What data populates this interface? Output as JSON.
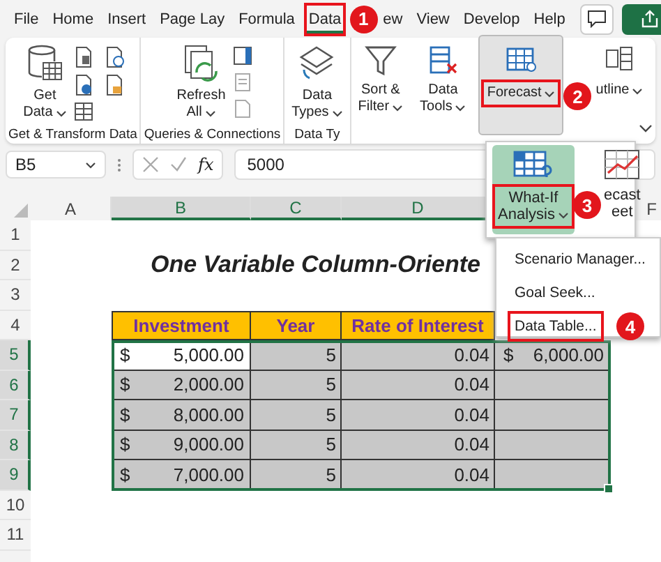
{
  "tabs": [
    {
      "label": "File",
      "selected": false
    },
    {
      "label": "Home",
      "selected": false
    },
    {
      "label": "Insert",
      "selected": false
    },
    {
      "label": "Page Lay",
      "selected": false
    },
    {
      "label": "Formula",
      "selected": false
    },
    {
      "label": "Data",
      "selected": true,
      "step": "1"
    },
    {
      "label": "ew",
      "selected": false
    },
    {
      "label": "View",
      "selected": false
    },
    {
      "label": "Develop",
      "selected": false
    },
    {
      "label": "Help",
      "selected": false
    }
  ],
  "ribbon_groups": [
    {
      "label": "Get & Transform Data",
      "buttons": [
        {
          "lines": [
            "Get",
            "Data"
          ],
          "dropdown": true,
          "pressed": false
        }
      ]
    },
    {
      "label": "Queries & Connections",
      "buttons": [
        {
          "lines": [
            "Refresh",
            "All"
          ],
          "dropdown": true,
          "pressed": false
        }
      ]
    },
    {
      "label": "Data Ty",
      "buttons": [
        {
          "lines": [
            "Data",
            "Types"
          ],
          "dropdown": true,
          "pressed": false
        }
      ]
    },
    {
      "buttons": [
        {
          "lines": [
            "Sort &",
            "Filter"
          ],
          "dropdown": true,
          "pressed": false
        },
        {
          "lines": [
            "Data",
            "Tools"
          ],
          "dropdown": true,
          "pressed": false
        },
        {
          "lines": [
            "Forecast"
          ],
          "dropdown": true,
          "pressed": true,
          "step": "2"
        },
        {
          "lines": [
            "utline"
          ],
          "dropdown": true,
          "pressed": false
        }
      ]
    }
  ],
  "formula_bar": {
    "name_box": "B5",
    "function_button": "fx",
    "value": "5000"
  },
  "forecast_panel": [
    {
      "lines": [
        "What-If",
        "Analysis"
      ],
      "dropdown": true,
      "selected": true,
      "step": "3"
    },
    {
      "lines": [
        "ecast",
        "eet"
      ],
      "dropdown": false,
      "selected": false
    }
  ],
  "what_if_menu": [
    {
      "label": "Scenario Manager..."
    },
    {
      "label": "Goal Seek..."
    },
    {
      "label": "Data Table...",
      "step": "4"
    }
  ],
  "column_headers": [
    {
      "label": "A",
      "selected": false
    },
    {
      "label": "B",
      "selected": true
    },
    {
      "label": "C",
      "selected": true
    },
    {
      "label": "D",
      "selected": true
    },
    {
      "label": "F",
      "selected": false
    }
  ],
  "sheet_rows": [
    {
      "header": "1",
      "selected": false,
      "kind": "blank"
    },
    {
      "header": "2",
      "selected": false,
      "kind": "title",
      "title": "One Variable Column-Oriente"
    },
    {
      "header": "3",
      "selected": false,
      "kind": "blank"
    },
    {
      "header": "4",
      "selected": false,
      "kind": "table_header",
      "cells": [
        "Investment",
        "Year",
        "Rate of Interest"
      ]
    },
    {
      "header": "5",
      "selected": true,
      "kind": "data",
      "active": true,
      "investment": {
        "currency": "$",
        "amount": "5,000.00"
      },
      "year": "5",
      "rate": "0.04",
      "result": {
        "currency": "$",
        "amount": "6,000.00"
      }
    },
    {
      "header": "6",
      "selected": true,
      "kind": "data",
      "active": false,
      "investment": {
        "currency": "$",
        "amount": "2,000.00"
      },
      "year": "5",
      "rate": "0.04"
    },
    {
      "header": "7",
      "selected": true,
      "kind": "data",
      "active": false,
      "investment": {
        "currency": "$",
        "amount": "8,000.00"
      },
      "year": "5",
      "rate": "0.04"
    },
    {
      "header": "8",
      "selected": true,
      "kind": "data",
      "active": false,
      "investment": {
        "currency": "$",
        "amount": "9,000.00"
      },
      "year": "5",
      "rate": "0.04"
    },
    {
      "header": "9",
      "selected": true,
      "kind": "data",
      "active": false,
      "investment": {
        "currency": "$",
        "amount": "7,000.00"
      },
      "year": "5",
      "rate": "0.04"
    },
    {
      "header": "10",
      "selected": false,
      "kind": "blank"
    },
    {
      "header": "11",
      "selected": false,
      "kind": "blank"
    }
  ]
}
